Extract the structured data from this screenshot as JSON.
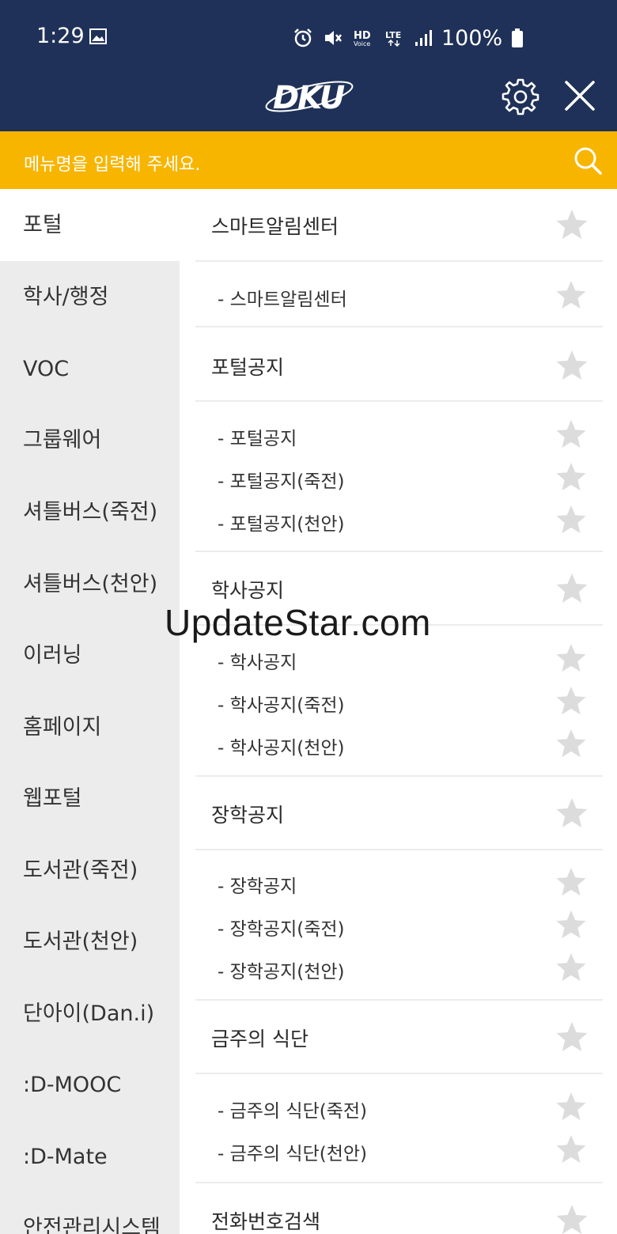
{
  "status_bar": {
    "time": "1:29",
    "battery": "100%"
  },
  "header": {
    "logo_text": "DKU"
  },
  "search": {
    "placeholder": "메뉴명을 입력해 주세요."
  },
  "sidebar": {
    "items": [
      {
        "label": "포털",
        "active": true
      },
      {
        "label": "학사/행정"
      },
      {
        "label": "VOC"
      },
      {
        "label": "그룹웨어"
      },
      {
        "label": "셔틀버스(죽전)"
      },
      {
        "label": "셔틀버스(천안)"
      },
      {
        "label": "이러닝"
      },
      {
        "label": "홈페이지"
      },
      {
        "label": "웹포털"
      },
      {
        "label": "도서관(죽전)"
      },
      {
        "label": "도서관(천안)"
      },
      {
        "label": "단아이(Dan.i)"
      },
      {
        "label": ":D-MOOC"
      },
      {
        "label": ":D-Mate"
      },
      {
        "label": "안전관리시스템"
      }
    ]
  },
  "menu": {
    "sections": [
      {
        "title": "스마트알림센터",
        "items": [
          "- 스마트알림센터"
        ]
      },
      {
        "title": "포털공지",
        "items": [
          "- 포털공지",
          "- 포털공지(죽전)",
          "- 포털공지(천안)"
        ]
      },
      {
        "title": "학사공지",
        "items": [
          "- 학사공지",
          "- 학사공지(죽전)",
          "- 학사공지(천안)"
        ]
      },
      {
        "title": "장학공지",
        "items": [
          "- 장학공지",
          "- 장학공지(죽전)",
          "- 장학공지(천안)"
        ]
      },
      {
        "title": "금주의 식단",
        "items": [
          "- 금주의 식단(죽전)",
          "- 금주의 식단(천안)"
        ]
      },
      {
        "title": "전화번호검색",
        "items": []
      }
    ]
  },
  "watermark": "UpdateStar.com",
  "colors": {
    "header_bg": "#1f3158",
    "search_bg": "#f7b500",
    "sidebar_bg": "#ececec",
    "star": "#dcdcdc"
  }
}
